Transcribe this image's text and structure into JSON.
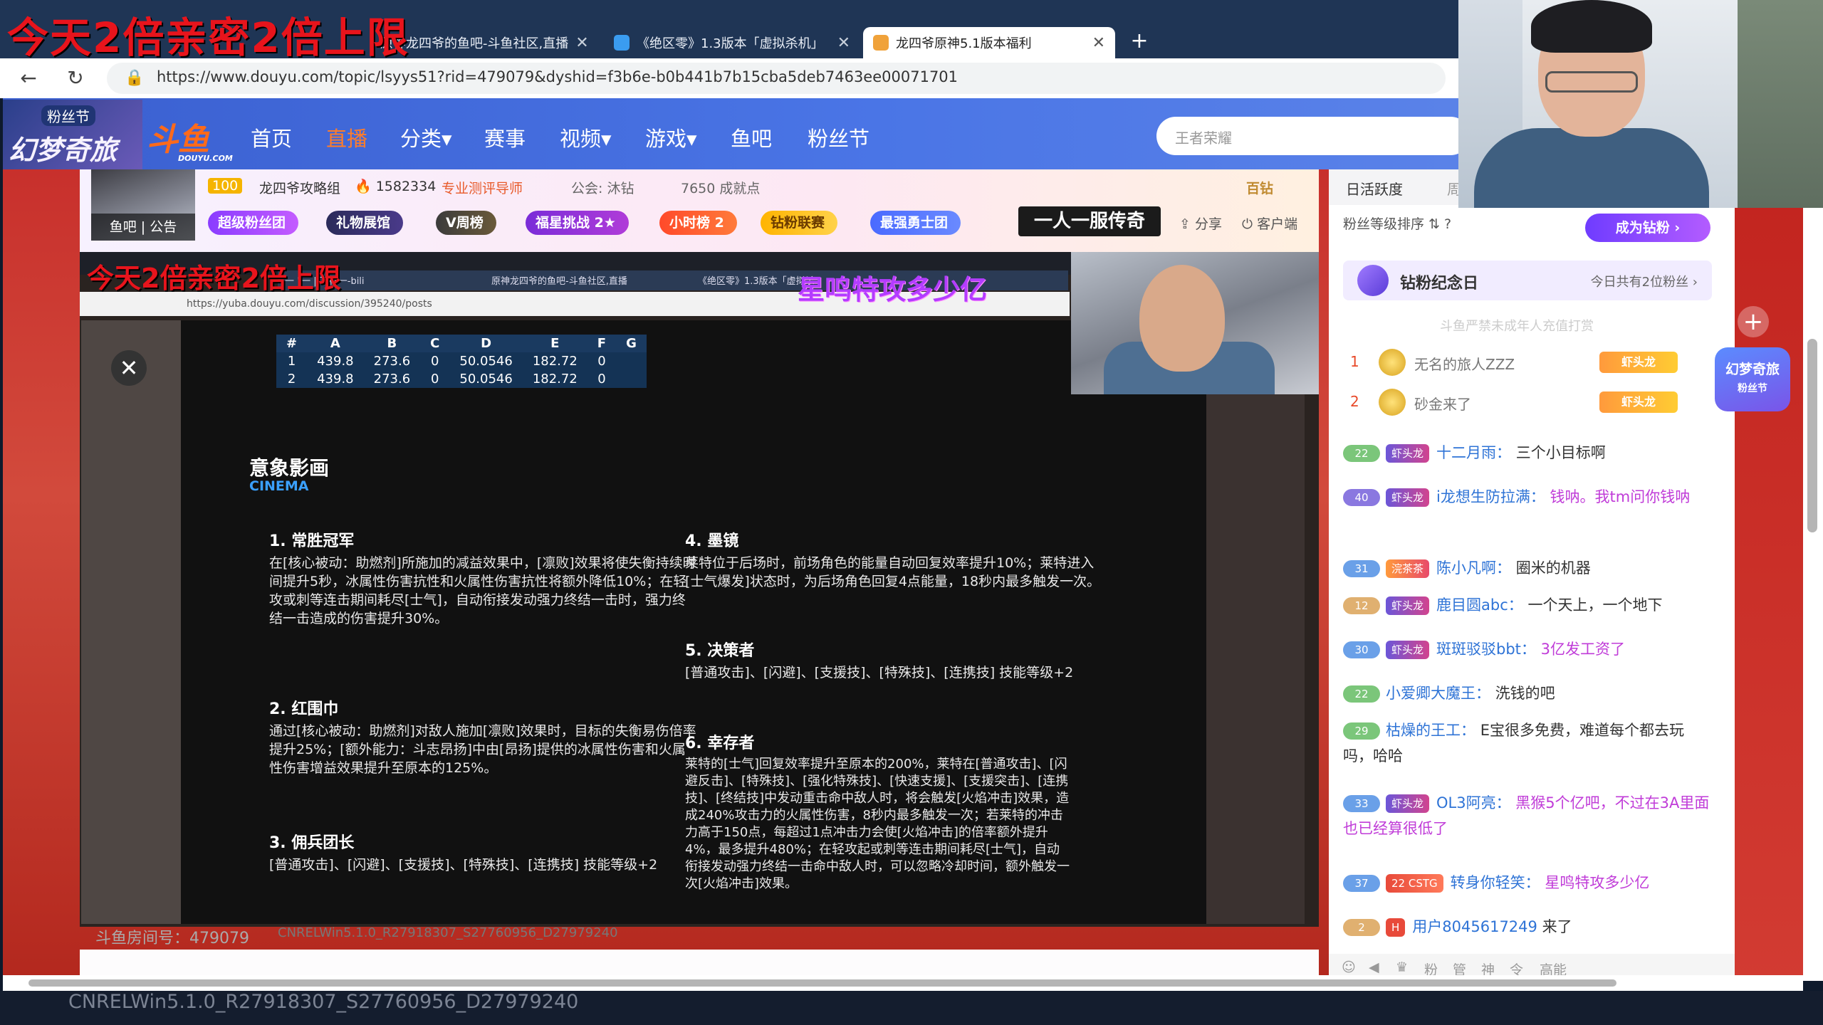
{
  "overlay": {
    "top_text": "今天2倍亲密2倍上限",
    "inner_text": "今天2倍亲密2倍上限",
    "slogan": "星鸣特攻多少亿"
  },
  "browser": {
    "tabs": [
      {
        "label": "原神龙四爷的鱼吧-斗鱼社区,直播",
        "active": false
      },
      {
        "label": "《绝区零》1.3版本「虚拟杀机」",
        "active": false
      },
      {
        "label": "龙四爷原神5.1版本福利",
        "active": true
      }
    ],
    "new_tab": "+",
    "url": "https://www.douyu.com/topic/lsyys51?rid=479079&dyshid=f3b6e-b0b441b7b15cba5deb7463ee00071701",
    "back": "←",
    "reload": "↻",
    "lock": "🔒"
  },
  "header": {
    "banner_tag": "粉丝节",
    "banner_title": "幻梦奇旅",
    "logo": "斗鱼",
    "logo_sub": "DOUYU.COM",
    "nav": [
      {
        "label": "首页",
        "active": false
      },
      {
        "label": "直播",
        "active": true
      },
      {
        "label": "分类▾",
        "active": false
      },
      {
        "label": "赛事",
        "active": false
      },
      {
        "label": "视频▾",
        "active": false
      },
      {
        "label": "游戏▾",
        "active": false
      },
      {
        "label": "鱼吧",
        "active": false
      },
      {
        "label": "粉丝节",
        "active": false
      }
    ],
    "search_placeholder": "王者荣耀"
  },
  "room": {
    "level": "100",
    "name": "龙四爷攻略组",
    "heat": "1582334",
    "tag": "专业测评导师",
    "guild": "公会: 沐钻",
    "achievement": "7650 成就点",
    "thumb_tag": "鱼吧 | 公告",
    "badges": [
      "超级粉丝团",
      "礼物展馆",
      "V周榜",
      "福星挑战 2★",
      "小时榜 2",
      "钻粉联赛",
      "最强勇士团"
    ],
    "slogan_box": "一人一服传奇",
    "share": "分享",
    "client": "客户端",
    "hundred": "百钻"
  },
  "video": {
    "inner_tabs": [
      "一 \"一 | 下杯一-bili",
      "原神龙四爷的鱼吧-斗鱼社区,直播",
      "《绝区零》1.3版本「虚拟杀"
    ],
    "inner_url": "https://yuba.douyu.com/discussion/395240/posts",
    "close": "✕",
    "table_headers": [
      "#",
      "A",
      "B",
      "C",
      "D",
      "E",
      "F",
      "G"
    ],
    "table_rows": [
      [
        "1",
        "439.8",
        "273.6",
        "0",
        "50.0546",
        "182.72",
        "0",
        ""
      ],
      [
        "2",
        "439.8",
        "273.6",
        "0",
        "50.0546",
        "182.72",
        "0",
        ""
      ]
    ],
    "doc_title": "意象影画",
    "doc_sub": "CINEMA",
    "sections": [
      {
        "title": "1. 常胜冠军",
        "body": "在[核心被动：助燃剂]所施加的减益效果中，[凛败]效果将使失衡持续时间提升5秒，冰属性伤害抗性和火属性伤害抗性将额外降低10%；在轻攻或刺等连击期间耗尽[士气]，自动衔接发动强力终结一击时，强力终结一击造成的伤害提升30%。"
      },
      {
        "title": "2. 红围巾",
        "body": "通过[核心被动：助燃剂]对敌人施加[凛败]效果时，目标的失衡易伤倍率提升25%；[额外能力：斗志昂扬]中由[昂扬]提供的冰属性伤害和火属性伤害增益效果提升至原本的125%。"
      },
      {
        "title": "3. 佣兵团长",
        "body": "[普通攻击]、[闪避]、[支援技]、[特殊技]、[连携技] 技能等级+2"
      },
      {
        "title": "4. 墨镜",
        "body": "莱特位于后场时，前场角色的能量自动回复效率提升10%；莱特进入[士气爆发]状态时，为后场角色回复4点能量，18秒内最多触发一次。"
      },
      {
        "title": "5. 决策者",
        "body": "[普通攻击]、[闪避]、[支援技]、[特殊技]、[连携技] 技能等级+2"
      },
      {
        "title": "6. 幸存者",
        "body": "莱特的[士气]回复效率提升至原本的200%，莱特在[普通攻击]、[闪避反击]、[特殊技]、[强化特殊技]、[快速支援]、[支援突击]、[连携技]、[终结技]中发动重击命中敌人时，将会触发[火焰冲击]效果，造成240%攻击力的火属性伤害，8秒内最多触发一次；若莱特的冲击力高于150点，每超过1点冲击力会使[火焰冲击]的倍率额外提升4%，最多提升480%；在轻攻起或刺等连击期间耗尽[士气]，自动衔接发动强力终结一击命中敌人时，可以忽略冷却时间，额外触发一次[火焰冲击]效果。"
      }
    ],
    "room_no": "斗鱼房间号：479079",
    "watermark": "CNRELWin5.1.0_R27918307_S27760956_D27979240"
  },
  "panel": {
    "tabs": [
      "日活跃度",
      "周"
    ],
    "fan_rank": "粉丝等级排序 ⇅ ?",
    "become_diamond": "成为钻粉 ›",
    "diamond_day": "钻粉纪念日",
    "diamond_today": "今日共有2位粉丝 ›",
    "rank_note": "斗鱼严禁未成年人充值打赏",
    "rank": [
      {
        "num": "1",
        "name": "无名的旅人ZZZ",
        "tag": "虾头龙"
      },
      {
        "num": "2",
        "name": "砂金来了",
        "tag": "虾头龙"
      }
    ],
    "event": "幻梦奇旅",
    "event_sub": "粉丝节",
    "plus": "+",
    "chats": [
      {
        "lv": "22",
        "lvcolor": "#7bc67a",
        "medal": "虾头龙",
        "user": "十二月雨：",
        "msg": "三个小目标啊",
        "hl": false
      },
      {
        "lv": "40",
        "lvcolor": "#8a78e0",
        "medal": "虾头龙",
        "user": "i龙想生防拉满：",
        "msg": "钱呐。我tm问你钱呐",
        "hl": true
      },
      {
        "lv": "31",
        "lvcolor": "#6aa0e8",
        "medal": "浣茶茶",
        "user": "陈小凡啊：",
        "msg": "圈米的机器",
        "hl": false
      },
      {
        "lv": "12",
        "lvcolor": "#e0b070",
        "medal": "虾头龙",
        "user": "鹿目圆abc：",
        "msg": "一个天上，一个地下",
        "hl": false
      },
      {
        "lv": "30",
        "lvcolor": "#6aa0e8",
        "medal": "虾头龙",
        "user": "斑斑驳驳bbt：",
        "msg": "3亿发工资了",
        "hl": true
      },
      {
        "lv": "22",
        "lvcolor": "#7bc67a",
        "medal": "",
        "user": "小爱卿大魔王：",
        "msg": "洗钱的吧",
        "hl": false
      },
      {
        "lv": "29",
        "lvcolor": "#7bc67a",
        "medal": "",
        "user": "枯燥的王工：",
        "msg": "E宝很多免费，难道每个都去玩吗，哈哈",
        "hl": false
      },
      {
        "lv": "33",
        "lvcolor": "#6aa0e8",
        "medal": "虾头龙",
        "user": "OL3阿亮：",
        "msg": "黑猴5个亿吧，不过在3A里面也已经算很低了",
        "hl": true
      },
      {
        "lv": "37",
        "lvcolor": "#6aa0e8",
        "medal": "22 CSTG",
        "user": "转身你轻笑：",
        "msg": "星鸣特攻多少亿",
        "hl": true
      },
      {
        "lv": "2",
        "lvcolor": "#e0b070",
        "medal": "H",
        "user": "用户8045617249",
        "msg": "来了",
        "hl": false
      }
    ],
    "tools": [
      "☺",
      "◀",
      "♛",
      "粉",
      "管",
      "神",
      "令",
      "高能"
    ]
  },
  "footer": {
    "build": "CNRELWin5.1.0_R27918307_S27760956_D27979240"
  }
}
